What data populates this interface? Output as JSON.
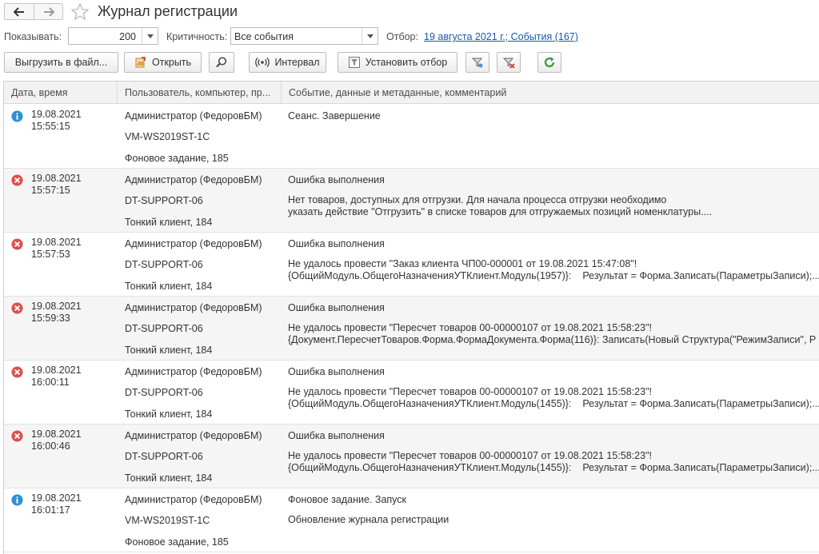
{
  "window": {
    "title": "Журнал регистрации"
  },
  "filters": {
    "show_label": "Показывать:",
    "show_value": "200",
    "criticality_label": "Критичность:",
    "criticality_value": "Все события",
    "selection_label": "Отбор:",
    "selection_link": "19 августа 2021 г.; События (167)"
  },
  "toolbar": {
    "export_label": "Выгрузить в файл...",
    "open_label": "Открыть",
    "interval_label": "Интервал",
    "set_filter_label": "Установить отбор"
  },
  "table": {
    "headers": [
      "Дата, время",
      "Пользователь, компьютер, пр...",
      "Событие, данные и метаданные, комментарий"
    ],
    "rows": [
      {
        "level": "info-icon",
        "date": "19.08.2021",
        "time": "15:55:15",
        "user": "Администратор (ФедоровБМ)",
        "computer": "VM-WS2019ST-1C",
        "application": "Фоновое задание, 185",
        "event": "Сеанс. Завершение",
        "data": ""
      },
      {
        "level": "error-icon",
        "date": "19.08.2021",
        "time": "15:57:15",
        "user": "Администратор (ФедоровБМ)",
        "computer": "DT-SUPPORT-06",
        "application": "Тонкий клиент, 184",
        "event": "Ошибка выполнения",
        "data": "Нет товаров, доступных для отгрузки. Для начала процесса отгрузки необходимо\nуказать действие \"Отгрузить\" в списке товаров для отгружаемых позиций номенклатуры...."
      },
      {
        "level": "error-icon",
        "date": "19.08.2021",
        "time": "15:57:53",
        "user": "Администратор (ФедоровБМ)",
        "computer": "DT-SUPPORT-06",
        "application": "Тонкий клиент, 184",
        "event": "Ошибка выполнения",
        "data": "Не удалось провести \"Заказ клиента ЧП00-000001 от 19.08.2021 15:47:08\"!\n{ОбщийМодуль.ОбщегоНазначенияУТКлиент.Модуль(1957)}:    Результат = Форма.Записать(ПараметрыЗаписи);..."
      },
      {
        "level": "error-icon",
        "date": "19.08.2021",
        "time": "15:59:33",
        "user": "Администратор (ФедоровБМ)",
        "computer": "DT-SUPPORT-06",
        "application": "Тонкий клиент, 184",
        "event": "Ошибка выполнения",
        "data": "Не удалось провести \"Пересчет товаров 00-00000107 от 19.08.2021 15:58:23\"!\n{Документ.ПересчетТоваров.Форма.ФормаДокумента.Форма(116)}: Записать(Новый Структура(\"РежимЗаписи\", Р"
      },
      {
        "level": "error-icon",
        "date": "19.08.2021",
        "time": "16:00:11",
        "user": "Администратор (ФедоровБМ)",
        "computer": "DT-SUPPORT-06",
        "application": "Тонкий клиент, 184",
        "event": "Ошибка выполнения",
        "data": "Не удалось провести \"Пересчет товаров 00-00000107 от 19.08.2021 15:58:23\"!\n{ОбщийМодуль.ОбщегоНазначенияУТКлиент.Модуль(1455)}:    Результат = Форма.Записать(ПараметрыЗаписи);..."
      },
      {
        "level": "error-icon",
        "date": "19.08.2021",
        "time": "16:00:46",
        "user": "Администратор (ФедоровБМ)",
        "computer": "DT-SUPPORT-06",
        "application": "Тонкий клиент, 184",
        "event": "Ошибка выполнения",
        "data": "Не удалось провести \"Пересчет товаров 00-00000107 от 19.08.2021 15:58:23\"!\n{ОбщийМодуль.ОбщегоНазначенияУТКлиент.Модуль(1455)}:    Результат = Форма.Записать(ПараметрыЗаписи);..."
      },
      {
        "level": "info-icon",
        "date": "19.08.2021",
        "time": "16:01:17",
        "user": "Администратор (ФедоровБМ)",
        "computer": "VM-WS2019ST-1C",
        "application": "Фоновое задание, 185",
        "event": "Фоновое задание. Запуск",
        "data": "Обновление журнала регистрации"
      }
    ]
  },
  "colors": {
    "info": "#2f8fd8",
    "error": "#d9534f",
    "link": "#1a5aa6",
    "refresh": "#3a9a3a"
  }
}
